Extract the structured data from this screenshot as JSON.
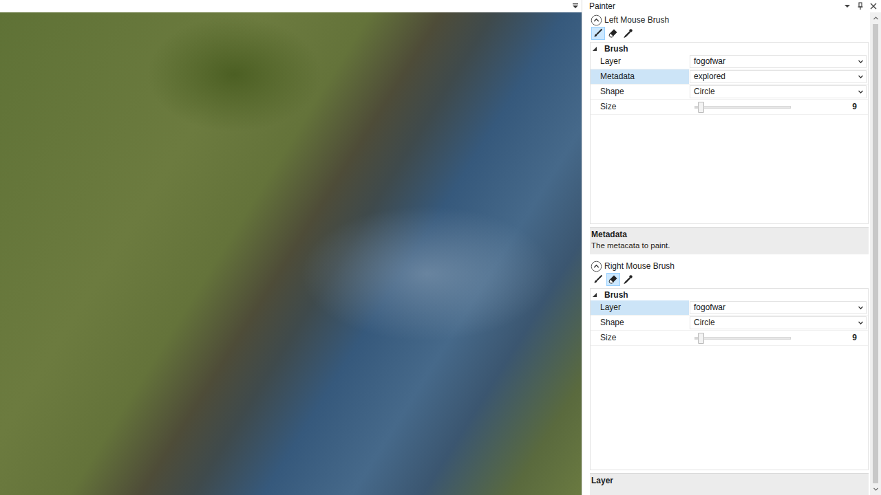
{
  "panel": {
    "title": "Painter"
  },
  "brushes": [
    {
      "title": "Left Mouse Brush",
      "expanded": true,
      "tools": [
        {
          "kind": "paint",
          "selected": true
        },
        {
          "kind": "erase",
          "selected": false
        },
        {
          "kind": "pick",
          "selected": false
        }
      ],
      "category": {
        "label": "Brush",
        "expanded": true
      },
      "properties": [
        {
          "label": "Layer",
          "kind": "dropdown",
          "value": "fogofwar",
          "selected": false
        },
        {
          "label": "Metadata",
          "kind": "dropdown",
          "value": "explored",
          "selected": true
        },
        {
          "label": "Shape",
          "kind": "dropdown",
          "value": "Circle",
          "selected": false
        },
        {
          "label": "Size",
          "kind": "slider",
          "value": "9",
          "level": 0.06,
          "selected": false
        }
      ],
      "description": {
        "title": "Metadata",
        "text": "The metacata to paint."
      }
    },
    {
      "title": "Right Mouse Brush",
      "expanded": true,
      "tools": [
        {
          "kind": "paint",
          "selected": false
        },
        {
          "kind": "erase",
          "selected": true
        },
        {
          "kind": "pick",
          "selected": false
        }
      ],
      "category": {
        "label": "Brush",
        "expanded": true
      },
      "properties": [
        {
          "label": "Layer",
          "kind": "dropdown",
          "value": "fogofwar",
          "selected": true
        },
        {
          "label": "Shape",
          "kind": "dropdown",
          "value": "Circle",
          "selected": false
        },
        {
          "label": "Size",
          "kind": "slider",
          "value": "9",
          "level": 0.06,
          "selected": false
        }
      ],
      "description": {
        "title": "Layer",
        "text": ""
      }
    }
  ]
}
